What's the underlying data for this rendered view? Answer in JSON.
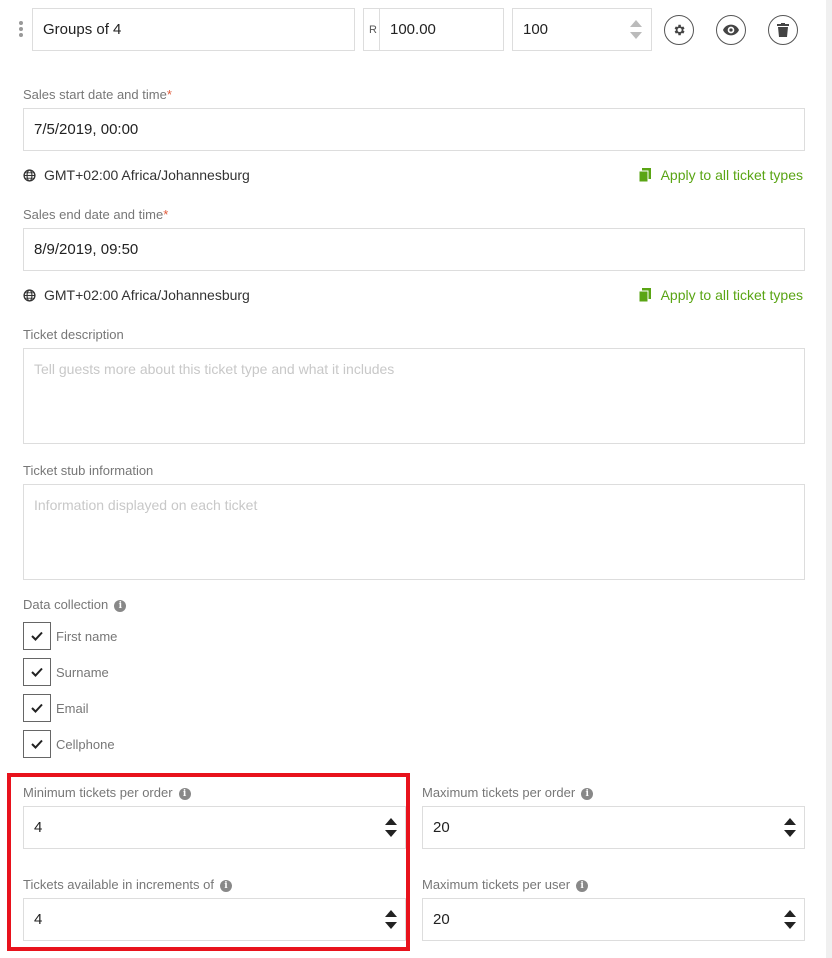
{
  "header": {
    "name_value": "Groups of 4",
    "currency_symbol": "R",
    "price_value": "100.00",
    "quantity_value": "100"
  },
  "sales_start": {
    "label": "Sales start date and time",
    "required_mark": "*",
    "value": "7/5/2019, 00:00",
    "timezone": "GMT+02:00 Africa/Johannesburg",
    "apply_label": "Apply to all ticket types"
  },
  "sales_end": {
    "label": "Sales end date and time",
    "required_mark": "*",
    "value": "8/9/2019, 09:50",
    "timezone": "GMT+02:00 Africa/Johannesburg",
    "apply_label": "Apply to all ticket types"
  },
  "description": {
    "label": "Ticket description",
    "placeholder": "Tell guests more about this ticket type and what it includes"
  },
  "stub": {
    "label": "Ticket stub information",
    "placeholder": "Information displayed on each ticket"
  },
  "data_collection": {
    "label": "Data collection",
    "items": [
      {
        "label": "First name",
        "checked": true
      },
      {
        "label": "Surname",
        "checked": true
      },
      {
        "label": "Email",
        "checked": true
      },
      {
        "label": "Cellphone",
        "checked": true
      }
    ]
  },
  "limits": {
    "min_per_order_label": "Minimum tickets per order",
    "min_per_order_value": "4",
    "max_per_order_label": "Maximum tickets per order",
    "max_per_order_value": "20",
    "increments_label": "Tickets available in increments of",
    "increments_value": "4",
    "max_per_user_label": "Maximum tickets per user",
    "max_per_user_value": "20"
  },
  "colors": {
    "accent_green": "#5aa514",
    "required_red": "#e05a3a",
    "highlight_red": "#e8121c"
  }
}
